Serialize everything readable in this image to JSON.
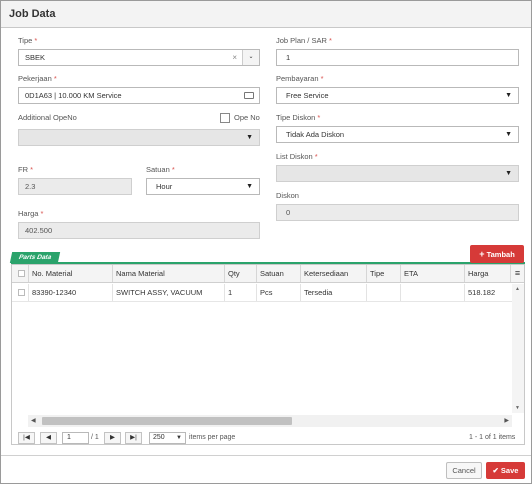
{
  "dialog": {
    "title": "Job Data"
  },
  "form": {
    "tipe": {
      "label": "Tipe",
      "value": "SBEK"
    },
    "job_plan": {
      "label": "Job Plan / SAR",
      "value": "1"
    },
    "pekerjaan": {
      "label": "Pekerjaan",
      "value": "0D1A63 | 10.000 KM Service"
    },
    "pembayaran": {
      "label": "Pembayaran",
      "value": "Free Service"
    },
    "additional_openo": {
      "label": "Additional OpeNo",
      "value": ""
    },
    "ope_no": {
      "label": "Ope No"
    },
    "tipe_diskon": {
      "label": "Tipe Diskon",
      "value": "Tidak Ada Diskon"
    },
    "list_diskon": {
      "label": "List Diskon",
      "value": ""
    },
    "fr": {
      "label": "FR",
      "value": "2.3"
    },
    "satuan": {
      "label": "Satuan",
      "value": "Hour"
    },
    "diskon": {
      "label": "Diskon",
      "value": "0"
    },
    "harga": {
      "label": "Harga",
      "value": "402.500"
    },
    "required_mark": "*"
  },
  "parts": {
    "badge": "Parts Data",
    "add_button": "Tambah",
    "columns": [
      "No. Material",
      "Nama Material",
      "Qty",
      "Satuan",
      "Ketersediaan",
      "Tipe",
      "ETA",
      "Harga"
    ],
    "rows": [
      {
        "no_material": "83390-12340",
        "nama_material": "SWITCH ASSY, VACUUM",
        "qty": "1",
        "satuan": "Pcs",
        "ketersediaan": "Tersedia",
        "tipe": "",
        "eta": "",
        "harga": "518.182"
      }
    ]
  },
  "pager": {
    "page": "1",
    "of_pages": "/ 1",
    "page_size": "250",
    "items_per_page": "items per page",
    "summary": "1 - 1 of 1 items"
  },
  "footer": {
    "cancel": "Cancel",
    "save": "Save"
  },
  "colors": {
    "accent_red": "#d63a38",
    "badge_green": "#2aa36b"
  },
  "icons": [
    "clear-icon",
    "chevron-down-icon",
    "card-icon",
    "plus-icon",
    "menu-icon",
    "check-icon",
    "first-page-icon",
    "prev-page-icon",
    "next-page-icon",
    "last-page-icon",
    "scroll-left-icon",
    "scroll-right-icon",
    "scroll-up-icon",
    "scroll-down-icon"
  ]
}
